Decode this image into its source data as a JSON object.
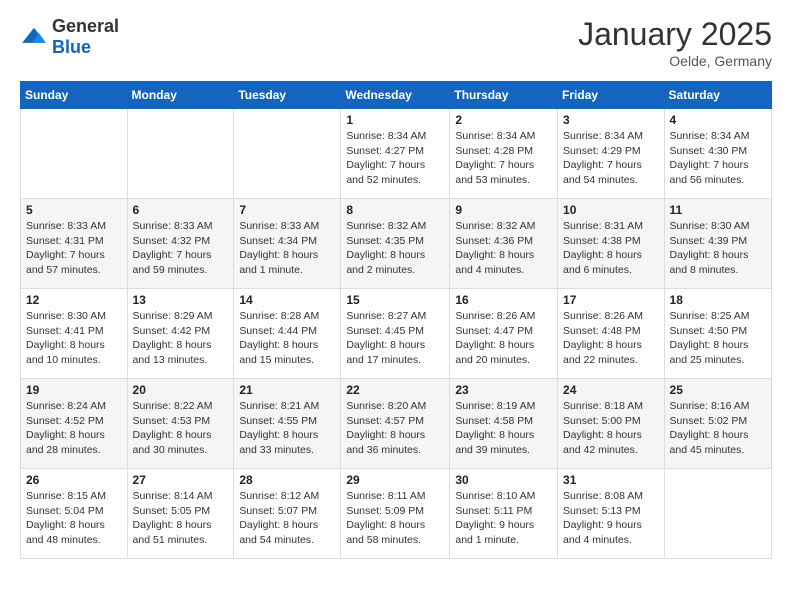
{
  "header": {
    "logo_general": "General",
    "logo_blue": "Blue",
    "month_title": "January 2025",
    "location": "Oelde, Germany"
  },
  "days_of_week": [
    "Sunday",
    "Monday",
    "Tuesday",
    "Wednesday",
    "Thursday",
    "Friday",
    "Saturday"
  ],
  "weeks": [
    [
      {
        "day": "",
        "info": ""
      },
      {
        "day": "",
        "info": ""
      },
      {
        "day": "",
        "info": ""
      },
      {
        "day": "1",
        "info": "Sunrise: 8:34 AM\nSunset: 4:27 PM\nDaylight: 7 hours and 52 minutes."
      },
      {
        "day": "2",
        "info": "Sunrise: 8:34 AM\nSunset: 4:28 PM\nDaylight: 7 hours and 53 minutes."
      },
      {
        "day": "3",
        "info": "Sunrise: 8:34 AM\nSunset: 4:29 PM\nDaylight: 7 hours and 54 minutes."
      },
      {
        "day": "4",
        "info": "Sunrise: 8:34 AM\nSunset: 4:30 PM\nDaylight: 7 hours and 56 minutes."
      }
    ],
    [
      {
        "day": "5",
        "info": "Sunrise: 8:33 AM\nSunset: 4:31 PM\nDaylight: 7 hours and 57 minutes."
      },
      {
        "day": "6",
        "info": "Sunrise: 8:33 AM\nSunset: 4:32 PM\nDaylight: 7 hours and 59 minutes."
      },
      {
        "day": "7",
        "info": "Sunrise: 8:33 AM\nSunset: 4:34 PM\nDaylight: 8 hours and 1 minute."
      },
      {
        "day": "8",
        "info": "Sunrise: 8:32 AM\nSunset: 4:35 PM\nDaylight: 8 hours and 2 minutes."
      },
      {
        "day": "9",
        "info": "Sunrise: 8:32 AM\nSunset: 4:36 PM\nDaylight: 8 hours and 4 minutes."
      },
      {
        "day": "10",
        "info": "Sunrise: 8:31 AM\nSunset: 4:38 PM\nDaylight: 8 hours and 6 minutes."
      },
      {
        "day": "11",
        "info": "Sunrise: 8:30 AM\nSunset: 4:39 PM\nDaylight: 8 hours and 8 minutes."
      }
    ],
    [
      {
        "day": "12",
        "info": "Sunrise: 8:30 AM\nSunset: 4:41 PM\nDaylight: 8 hours and 10 minutes."
      },
      {
        "day": "13",
        "info": "Sunrise: 8:29 AM\nSunset: 4:42 PM\nDaylight: 8 hours and 13 minutes."
      },
      {
        "day": "14",
        "info": "Sunrise: 8:28 AM\nSunset: 4:44 PM\nDaylight: 8 hours and 15 minutes."
      },
      {
        "day": "15",
        "info": "Sunrise: 8:27 AM\nSunset: 4:45 PM\nDaylight: 8 hours and 17 minutes."
      },
      {
        "day": "16",
        "info": "Sunrise: 8:26 AM\nSunset: 4:47 PM\nDaylight: 8 hours and 20 minutes."
      },
      {
        "day": "17",
        "info": "Sunrise: 8:26 AM\nSunset: 4:48 PM\nDaylight: 8 hours and 22 minutes."
      },
      {
        "day": "18",
        "info": "Sunrise: 8:25 AM\nSunset: 4:50 PM\nDaylight: 8 hours and 25 minutes."
      }
    ],
    [
      {
        "day": "19",
        "info": "Sunrise: 8:24 AM\nSunset: 4:52 PM\nDaylight: 8 hours and 28 minutes."
      },
      {
        "day": "20",
        "info": "Sunrise: 8:22 AM\nSunset: 4:53 PM\nDaylight: 8 hours and 30 minutes."
      },
      {
        "day": "21",
        "info": "Sunrise: 8:21 AM\nSunset: 4:55 PM\nDaylight: 8 hours and 33 minutes."
      },
      {
        "day": "22",
        "info": "Sunrise: 8:20 AM\nSunset: 4:57 PM\nDaylight: 8 hours and 36 minutes."
      },
      {
        "day": "23",
        "info": "Sunrise: 8:19 AM\nSunset: 4:58 PM\nDaylight: 8 hours and 39 minutes."
      },
      {
        "day": "24",
        "info": "Sunrise: 8:18 AM\nSunset: 5:00 PM\nDaylight: 8 hours and 42 minutes."
      },
      {
        "day": "25",
        "info": "Sunrise: 8:16 AM\nSunset: 5:02 PM\nDaylight: 8 hours and 45 minutes."
      }
    ],
    [
      {
        "day": "26",
        "info": "Sunrise: 8:15 AM\nSunset: 5:04 PM\nDaylight: 8 hours and 48 minutes."
      },
      {
        "day": "27",
        "info": "Sunrise: 8:14 AM\nSunset: 5:05 PM\nDaylight: 8 hours and 51 minutes."
      },
      {
        "day": "28",
        "info": "Sunrise: 8:12 AM\nSunset: 5:07 PM\nDaylight: 8 hours and 54 minutes."
      },
      {
        "day": "29",
        "info": "Sunrise: 8:11 AM\nSunset: 5:09 PM\nDaylight: 8 hours and 58 minutes."
      },
      {
        "day": "30",
        "info": "Sunrise: 8:10 AM\nSunset: 5:11 PM\nDaylight: 9 hours and 1 minute."
      },
      {
        "day": "31",
        "info": "Sunrise: 8:08 AM\nSunset: 5:13 PM\nDaylight: 9 hours and 4 minutes."
      },
      {
        "day": "",
        "info": ""
      }
    ]
  ]
}
